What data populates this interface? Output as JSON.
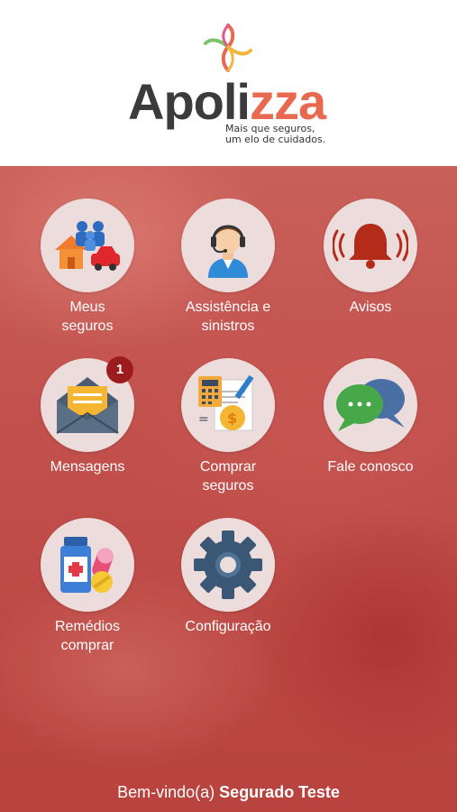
{
  "brand": {
    "name_part1": "Apoli",
    "name_part2": "zza",
    "tagline_line1": "Mais que seguros,",
    "tagline_line2": "um elo de cuidados."
  },
  "menu": {
    "meus_seguros": {
      "line1": "Meus",
      "line2": "seguros",
      "icon": "family-house-car-icon"
    },
    "assistencia": {
      "line1": "Assistência e",
      "line2": "sinistros",
      "icon": "support-agent-icon"
    },
    "avisos": {
      "line1": "Avisos",
      "icon": "bell-icon"
    },
    "mensagens": {
      "line1": "Mensagens",
      "icon": "envelope-icon",
      "badge": "1"
    },
    "comprar_seguros": {
      "line1": "Comprar",
      "line2": "seguros",
      "icon": "calculator-document-icon"
    },
    "fale_conosco": {
      "line1": "Fale conosco",
      "icon": "chat-bubbles-icon"
    },
    "remedios": {
      "line1": "Remédios",
      "line2": "comprar",
      "icon": "medicine-icon"
    },
    "configuracao": {
      "line1": "Configuração",
      "icon": "gear-icon"
    }
  },
  "footer": {
    "greeting": "Bem-vindo(a)",
    "user_name": "Segurado Teste"
  },
  "colors": {
    "brand_dark": "#3b3b3d",
    "brand_accent": "#e8694f",
    "background_red": "#c2504c",
    "footer_red": "#b9433f",
    "badge_red": "#9b1b1f"
  }
}
